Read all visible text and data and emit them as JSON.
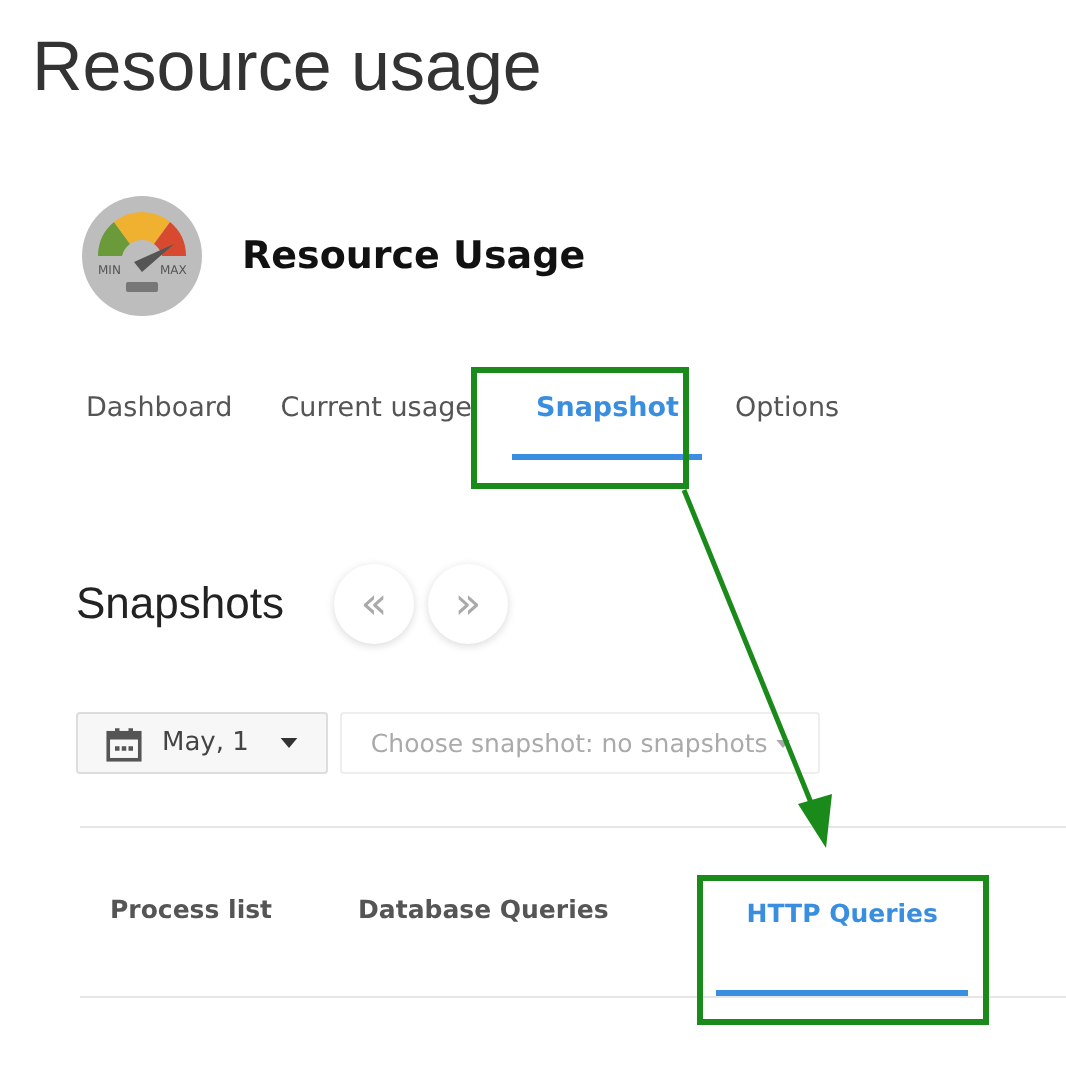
{
  "page_title": "Resource usage",
  "plugin": {
    "name": "Resource Usage",
    "logo_labels": [
      "MIN",
      "MAX"
    ]
  },
  "tabs": [
    {
      "label": "Dashboard",
      "selected": false
    },
    {
      "label": "Current usage",
      "selected": false
    },
    {
      "label": "Snapshot",
      "selected": true
    },
    {
      "label": "Options",
      "selected": false
    }
  ],
  "snapshots": {
    "title": "Snapshots",
    "prev": "«",
    "next": "»",
    "date": "May, 1",
    "snapshot_select": "Choose snapshot: no snapshots"
  },
  "subtabs": [
    {
      "label": "Process list",
      "selected": false
    },
    {
      "label": "Database Queries",
      "selected": false
    },
    {
      "label": "HTTP Queries",
      "selected": true
    }
  ]
}
